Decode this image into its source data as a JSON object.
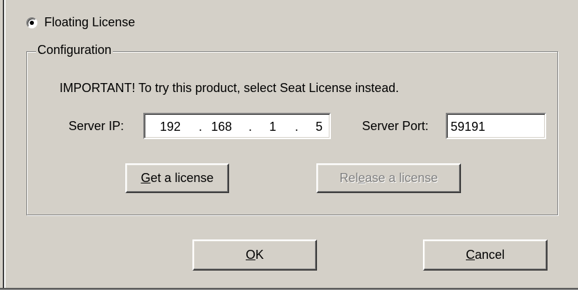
{
  "license_option": {
    "label": "Floating License",
    "selected": true
  },
  "configuration": {
    "group_title": "Configuration",
    "important_note": "IMPORTANT! To try this product, select Seat License instead.",
    "server_ip_label": "Server IP:",
    "server_ip": {
      "octet1": "192",
      "octet2": "168",
      "octet3": "1",
      "octet4": "5",
      "dot": "."
    },
    "server_port_label": "Server Port:",
    "server_port": "59191",
    "get_license": {
      "prefix": "",
      "mnemonic": "G",
      "rest": "et a license",
      "enabled": true
    },
    "release_license": {
      "prefix": "Rel",
      "mnemonic": "e",
      "rest": "ase a license",
      "enabled": false
    }
  },
  "dialog_buttons": {
    "ok": {
      "mnemonic": "O",
      "rest": "K"
    },
    "cancel": {
      "mnemonic": "C",
      "rest": "ancel"
    }
  }
}
